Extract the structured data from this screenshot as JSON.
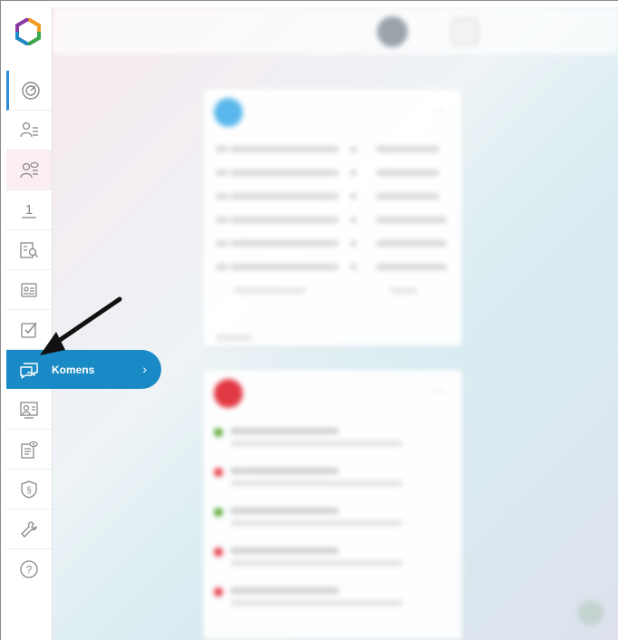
{
  "sidebar": {
    "items": [
      {
        "name": "dashboard"
      },
      {
        "name": "people-list"
      },
      {
        "name": "people-view"
      },
      {
        "name": "grades"
      },
      {
        "name": "documents-search"
      },
      {
        "name": "id-card"
      },
      {
        "name": "tasks"
      },
      {
        "name": "komens",
        "label": "Komens"
      },
      {
        "name": "classroom"
      },
      {
        "name": "reports"
      },
      {
        "name": "shield"
      },
      {
        "name": "settings"
      },
      {
        "name": "help"
      }
    ]
  },
  "komens_label": "Komens",
  "chevron": "›",
  "grade_symbol": "1",
  "help_symbol": "?",
  "colors": {
    "accent": "#1a8ac6",
    "sidebar_bar": "#2b8ad8",
    "card1_circle": "#5bb8ec",
    "card2_circle": "#e23a44",
    "green": "#5aa838",
    "red": "#e23a44"
  }
}
